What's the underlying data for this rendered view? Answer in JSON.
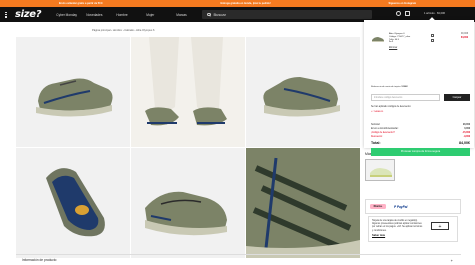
{
  "promo": {
    "items": [
      "Envío estándar gratis a partir de 50 €",
      "Entrega gratuita en tienda, ¡Haz tu pedido!",
      "Siguenos en Instagram"
    ]
  },
  "header": {
    "logo": "size?",
    "nav": [
      "Cyber Monday",
      "Novedades",
      "Hombre",
      "Mujer",
      "Marcas"
    ],
    "search_placeholder": "Buscar",
    "account": "1 artículo · 84,00€"
  },
  "breadcrumb": "Página principal  ›  Hombre  ›  Calzado  ›  Altra Olympus 6",
  "product": {
    "size_label": "Talla",
    "colors_title": "Más colores disponibles",
    "payments": {
      "klarna": "Klarna.",
      "paypal": "P PayPal"
    },
    "gift": {
      "text": "Tarjeta de una tarjeta de crédito en regalo(s). Algunos proveedores podrían aplicar comisiones por retirar en los pagos. +18. Se aplican términos y condiciones.",
      "link": "Saber más",
      "plus": "+"
    },
    "info_bar": "Información de producto",
    "info_plus": "+"
  },
  "cart": {
    "item": {
      "name": "Altra Olympus 6",
      "variant": "Código: 715077_olive",
      "size": "Talla: 40.5",
      "qty": "1x 1",
      "old_price": "90,00€",
      "new_price": "84,00€",
      "remove": "Eliminar"
    },
    "ref_label": "Referencia de venta de tarjeta:",
    "ref_value": "51082",
    "code_placeholder": "Introduce código descuento",
    "code_button": "Canjear",
    "applied_title": "Se han aplicado códigos de descuento:",
    "applied_code": "✕ THREE15",
    "summary": [
      {
        "label": "Subtotal:",
        "value": "90,00€",
        "red": false
      },
      {
        "label": "Envío a domicilio/estándar:",
        "value": "0,00€",
        "red": false
      },
      {
        "label": "¡Código de descuento?",
        "value": "-15,00€",
        "red": true
      },
      {
        "label": "Descuento:",
        "value": "-9,00€",
        "red": true
      }
    ],
    "total_label": "Total:",
    "total_value": "84,00€",
    "checkout": "Procesar compra de forma segura"
  },
  "colors": {
    "promo_bg": "#f47a20",
    "header_bg": "#111111",
    "checkout_bg": "#2ecc71",
    "sale_red": "#e3001b",
    "shoe_olive": "#7c8367",
    "shoe_navy": "#1f3a6b",
    "pants_white": "#e9e6de"
  }
}
